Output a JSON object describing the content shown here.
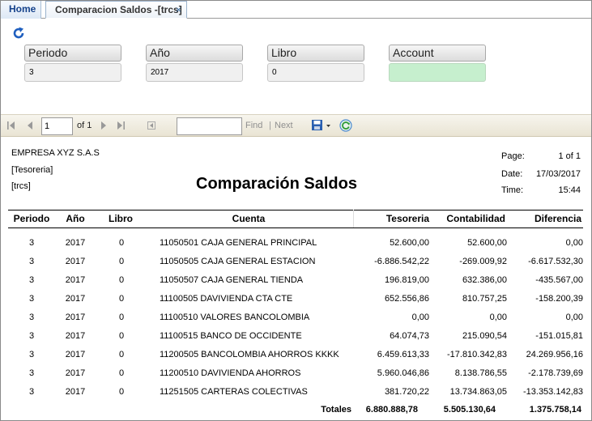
{
  "tabs": {
    "home": "Home",
    "active": "Comparacion Saldos -[trcs]",
    "close": "×"
  },
  "params": {
    "periodo_label": "Periodo",
    "periodo_value": "3",
    "anio_label": "Año",
    "anio_value": "2017",
    "libro_label": "Libro",
    "libro_value": "0",
    "account_label": "Account",
    "account_value": ""
  },
  "toolbar": {
    "page_value": "1",
    "of_label": "of 1",
    "find_label": "Find",
    "separator": "|",
    "next_label": "Next",
    "search_value": ""
  },
  "report": {
    "company": "EMPRESA XYZ S.A.S",
    "dept": "[Tesoreria]",
    "code": "[trcs]",
    "title": "Comparación Saldos",
    "page_label": "Page:",
    "page_value": "1 of 1",
    "date_label": "Date:",
    "date_value": "17/03/2017",
    "time_label": "Time:",
    "time_value": "15:44",
    "columns": [
      "Periodo",
      "Año",
      "Libro",
      "Cuenta",
      "Tesoreria",
      "Contabilidad",
      "Diferencia"
    ],
    "rows": [
      {
        "periodo": "3",
        "anio": "2017",
        "libro": "0",
        "cuenta": "11050501 CAJA GENERAL PRINCIPAL",
        "tesoreria": "52.600,00",
        "contabilidad": "52.600,00",
        "diferencia": "0,00"
      },
      {
        "periodo": "3",
        "anio": "2017",
        "libro": "0",
        "cuenta": "11050505 CAJA GENERAL ESTACION",
        "tesoreria": "-6.886.542,22",
        "contabilidad": "-269.009,92",
        "diferencia": "-6.617.532,30"
      },
      {
        "periodo": "3",
        "anio": "2017",
        "libro": "0",
        "cuenta": "11050507 CAJA GENERAL TIENDA",
        "tesoreria": "196.819,00",
        "contabilidad": "632.386,00",
        "diferencia": "-435.567,00"
      },
      {
        "periodo": "3",
        "anio": "2017",
        "libro": "0",
        "cuenta": "11100505 DAVIVIENDA CTA CTE",
        "tesoreria": "652.556,86",
        "contabilidad": "810.757,25",
        "diferencia": "-158.200,39"
      },
      {
        "periodo": "3",
        "anio": "2017",
        "libro": "0",
        "cuenta": "11100510 VALORES BANCOLOMBIA",
        "tesoreria": "0,00",
        "contabilidad": "0,00",
        "diferencia": "0,00"
      },
      {
        "periodo": "3",
        "anio": "2017",
        "libro": "0",
        "cuenta": "11100515 BANCO DE OCCIDENTE",
        "tesoreria": "64.074,73",
        "contabilidad": "215.090,54",
        "diferencia": "-151.015,81"
      },
      {
        "periodo": "3",
        "anio": "2017",
        "libro": "0",
        "cuenta": "11200505 BANCOLOMBIA AHORROS KKKK",
        "tesoreria": "6.459.613,33",
        "contabilidad": "-17.810.342,83",
        "diferencia": "24.269.956,16"
      },
      {
        "periodo": "3",
        "anio": "2017",
        "libro": "0",
        "cuenta": "11200510 DAVIVIENDA AHORROS",
        "tesoreria": "5.960.046,86",
        "contabilidad": "8.138.786,55",
        "diferencia": "-2.178.739,69"
      },
      {
        "periodo": "3",
        "anio": "2017",
        "libro": "0",
        "cuenta": "11251505 CARTERAS COLECTIVAS",
        "tesoreria": "381.720,22",
        "contabilidad": "13.734.863,05",
        "diferencia": "-13.353.142,83"
      }
    ],
    "totals_label": "Totales",
    "totals": {
      "tesoreria": "6.880.888,78",
      "contabilidad": "5.505.130,64",
      "diferencia": "1.375.758,14"
    }
  }
}
